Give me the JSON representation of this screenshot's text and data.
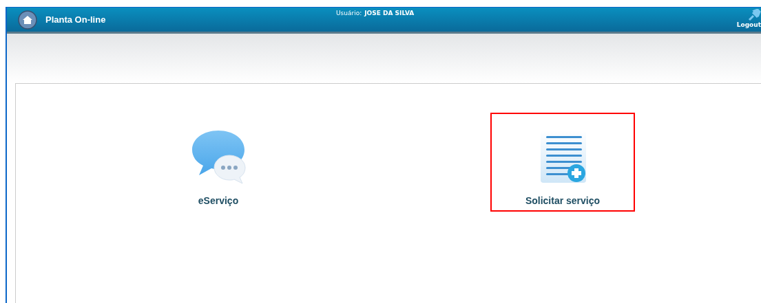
{
  "header": {
    "title": "Planta On-line",
    "user_label": "Usuário:",
    "user_name": "JOSE DA SILVA",
    "logout": "Logout"
  },
  "tiles": [
    {
      "kind": "chat",
      "label": "eServiço",
      "selected": false
    },
    {
      "kind": "list-add",
      "label": "Solicitar serviço",
      "selected": true
    }
  ]
}
